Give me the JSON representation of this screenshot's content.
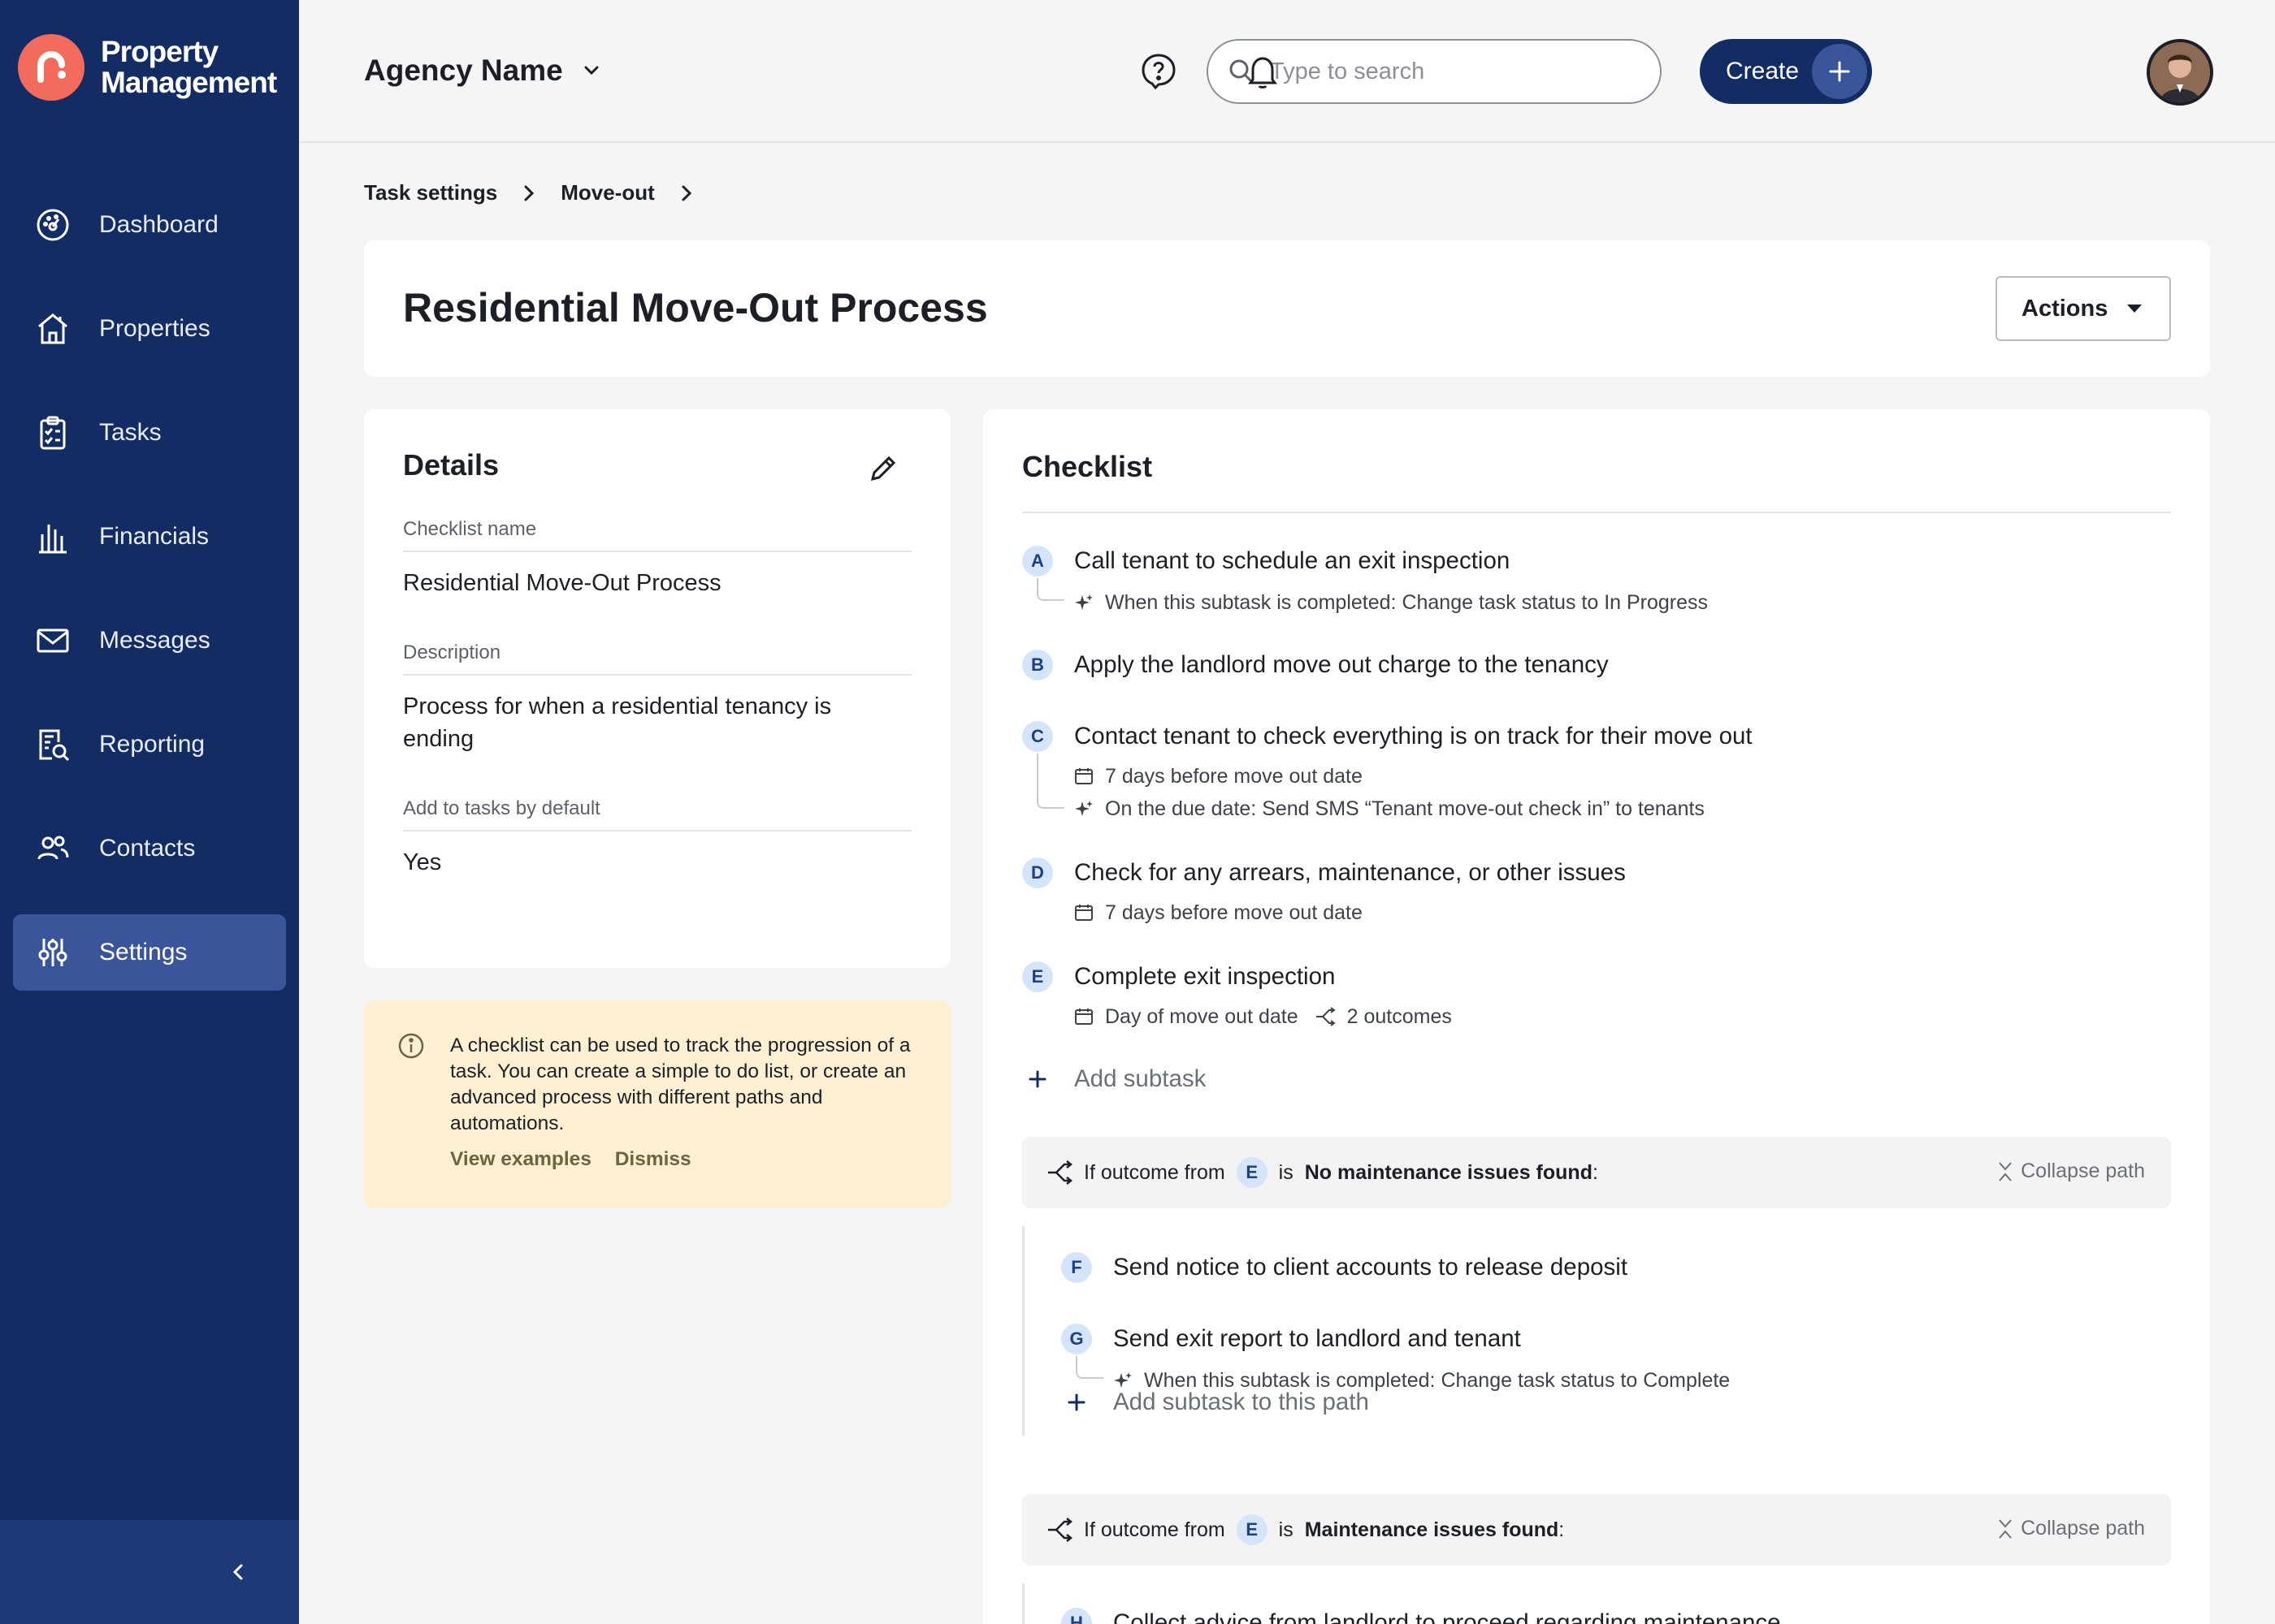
{
  "brand": {
    "name_line1": "Property",
    "name_line2": "Management"
  },
  "nav": [
    {
      "label": "Dashboard",
      "icon": "dashboard-icon"
    },
    {
      "label": "Properties",
      "icon": "house-icon"
    },
    {
      "label": "Tasks",
      "icon": "clipboard-icon"
    },
    {
      "label": "Financials",
      "icon": "bank-icon"
    },
    {
      "label": "Messages",
      "icon": "mail-icon"
    },
    {
      "label": "Reporting",
      "icon": "report-icon"
    },
    {
      "label": "Contacts",
      "icon": "people-icon"
    },
    {
      "label": "Settings",
      "icon": "sliders-icon",
      "active": true
    }
  ],
  "header": {
    "agency": "Agency Name",
    "search_placeholder": "Type to search",
    "create_label": "Create"
  },
  "breadcrumb": [
    "Task settings",
    "Move-out"
  ],
  "page": {
    "title": "Residential Move-Out Process",
    "actions_label": "Actions"
  },
  "details": {
    "title": "Details",
    "fields": [
      {
        "label": "Checklist name",
        "value": "Residential Move-Out Process"
      },
      {
        "label": "Description",
        "value": "Process for when a residential tenancy is ending"
      },
      {
        "label": "Add to tasks by default",
        "value": "Yes"
      }
    ]
  },
  "info": {
    "text": "A checklist can be used to track the progression of a task. You can create a simple to do list, or create an advanced process with different paths and automations.",
    "view_examples": "View examples",
    "dismiss": "Dismiss"
  },
  "checklist": {
    "title": "Checklist",
    "subtasks": [
      {
        "letter": "A",
        "title": "Call tenant to schedule an exit inspection",
        "automation": "When this subtask is completed: Change task status to In Progress"
      },
      {
        "letter": "B",
        "title": "Apply the landlord move out charge to the tenancy"
      },
      {
        "letter": "C",
        "title": "Contact tenant to check everything is on track for their move out",
        "due": "7 days before move out date",
        "automation": "On the due date: Send SMS “Tenant move-out check in” to tenants"
      },
      {
        "letter": "D",
        "title": "Check for any arrears, maintenance, or other issues",
        "due": "7 days before move out date"
      },
      {
        "letter": "E",
        "title": "Complete exit inspection",
        "due": "Day of move out date",
        "outcomes": "2 outcomes"
      }
    ],
    "add_subtask": "Add subtask",
    "paths": [
      {
        "prefix": "If outcome from",
        "letter": "E",
        "is": "is",
        "outcome": "No maintenance issues found",
        "suffix": ":",
        "collapse": "Collapse path",
        "subtasks": [
          {
            "letter": "F",
            "title": "Send notice to client accounts to release deposit"
          },
          {
            "letter": "G",
            "title": "Send exit report to landlord and tenant",
            "automation": "When this subtask is completed: Change task status to Complete"
          }
        ],
        "add_label": "Add subtask to this path"
      },
      {
        "prefix": "If outcome from",
        "letter": "E",
        "is": "is",
        "outcome": "Maintenance issues found",
        "suffix": ":",
        "collapse": "Collapse path",
        "subtasks": [
          {
            "letter": "H",
            "title": "Collect advice from landlord to proceed regarding maintenance"
          }
        ]
      }
    ]
  },
  "colors": {
    "sidebar": "#132c63",
    "active_nav": "#3a5599",
    "accent_logo": "#f26b5c",
    "badge_bg": "#d4e5fb",
    "info_bg": "#fdefd2"
  }
}
